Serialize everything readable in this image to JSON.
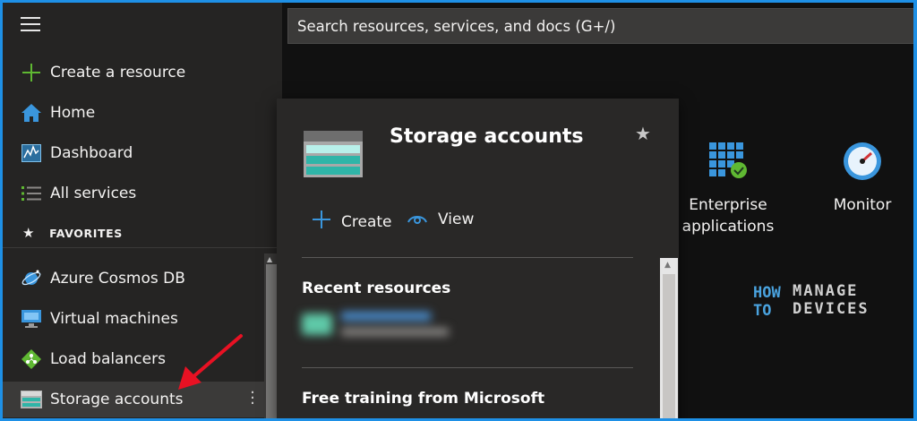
{
  "search": {
    "placeholder": "Search resources, services, and docs (G+/)"
  },
  "sidebar": {
    "top_items": [
      {
        "label": "Create a resource",
        "icon": "plus-icon"
      },
      {
        "label": "Home",
        "icon": "home-icon"
      },
      {
        "label": "Dashboard",
        "icon": "dashboard-icon"
      },
      {
        "label": "All services",
        "icon": "list-icon"
      }
    ],
    "favorites_header": "FAVORITES",
    "favorites": [
      {
        "label": "Azure Cosmos DB",
        "icon": "cosmos-db-icon"
      },
      {
        "label": "Virtual machines",
        "icon": "virtual-machine-icon"
      },
      {
        "label": "Load balancers",
        "icon": "load-balancer-icon"
      },
      {
        "label": "Storage accounts",
        "icon": "storage-icon",
        "selected": true
      }
    ]
  },
  "services": [
    {
      "label_line1": "Enterprise",
      "label_line2": "applications",
      "icon": "enterprise-apps-icon"
    },
    {
      "label_line1": "Monitor",
      "label_line2": "",
      "icon": "monitor-icon"
    }
  ],
  "card": {
    "title": "Storage accounts",
    "create_label": "Create",
    "view_label": "View",
    "recent_title": "Recent resources",
    "training_title": "Free training from Microsoft"
  },
  "watermark": {
    "line1": "HOW",
    "line2": "TO",
    "line3": "MANAGE",
    "line4": "DEVICES"
  },
  "colors": {
    "accent_blue": "#0078d4",
    "frame_border": "#1e90e6",
    "annotation_arrow": "#e81123"
  }
}
